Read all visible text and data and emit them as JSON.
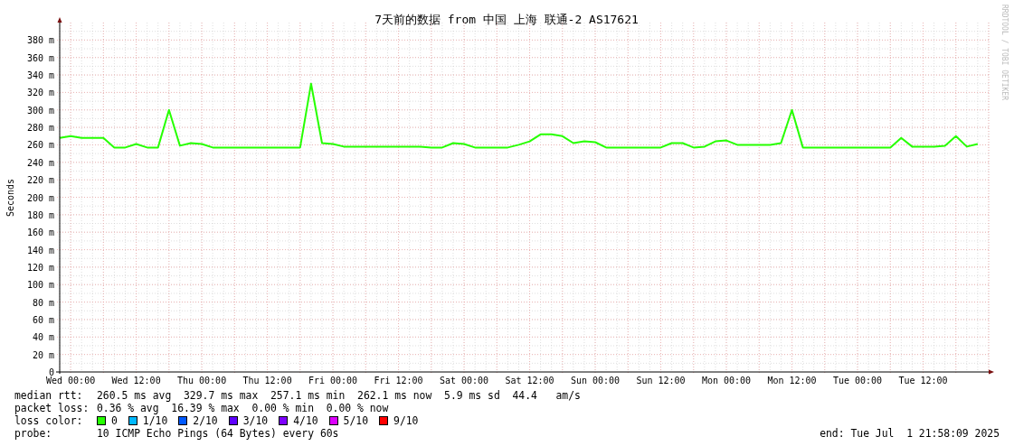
{
  "graph": {
    "watermark": "RRDTOOL / TOBI OETIKER",
    "chart_data": {
      "type": "line",
      "title": "7天前的数据 from 中国 上海 联通-2 AS17621",
      "ylabel": "Seconds",
      "ylim": [
        0,
        400
      ],
      "grid": true,
      "categories": [
        null,
        "Wed 00:00",
        null,
        null,
        null,
        null,
        null,
        "Wed 12:00",
        null,
        null,
        null,
        null,
        null,
        "Thu 00:00",
        null,
        null,
        null,
        null,
        null,
        "Thu 12:00",
        null,
        null,
        null,
        null,
        null,
        "Fri 00:00",
        null,
        null,
        null,
        null,
        null,
        "Fri 12:00",
        null,
        null,
        null,
        null,
        null,
        "Sat 00:00",
        null,
        null,
        null,
        null,
        null,
        "Sat 12:00",
        null,
        null,
        null,
        null,
        null,
        "Sun 00:00",
        null,
        null,
        null,
        null,
        null,
        "Sun 12:00",
        null,
        null,
        null,
        null,
        null,
        "Mon 00:00",
        null,
        null,
        null,
        null,
        null,
        "Mon 12:00",
        null,
        null,
        null,
        null,
        null,
        "Tue 00:00",
        null,
        null,
        null,
        null,
        null,
        "Tue 12:00",
        null,
        null,
        null,
        null,
        null
      ],
      "yticks": [
        {
          "value": 0,
          "label": "0"
        },
        {
          "value": 20,
          "label": "20 m"
        },
        {
          "value": 40,
          "label": "40 m"
        },
        {
          "value": 60,
          "label": "60 m"
        },
        {
          "value": 80,
          "label": "80 m"
        },
        {
          "value": 100,
          "label": "100 m"
        },
        {
          "value": 120,
          "label": "120 m"
        },
        {
          "value": 140,
          "label": "140 m"
        },
        {
          "value": 160,
          "label": "160 m"
        },
        {
          "value": 180,
          "label": "180 m"
        },
        {
          "value": 200,
          "label": "200 m"
        },
        {
          "value": 220,
          "label": "220 m"
        },
        {
          "value": 240,
          "label": "240 m"
        },
        {
          "value": 260,
          "label": "260 m"
        },
        {
          "value": 280,
          "label": "280 m"
        },
        {
          "value": 300,
          "label": "300 m"
        },
        {
          "value": 320,
          "label": "320 m"
        },
        {
          "value": 340,
          "label": "340 m"
        },
        {
          "value": 360,
          "label": "360 m"
        },
        {
          "value": 380,
          "label": "380 m"
        }
      ],
      "series": [
        {
          "name": "median rtt:",
          "color": "#26ff00",
          "values": [
            268,
            270,
            268,
            268,
            268,
            257,
            257,
            261,
            257,
            257,
            300,
            259,
            262,
            261,
            257,
            257,
            257,
            257,
            257,
            257,
            257,
            257,
            257,
            330,
            262,
            261,
            258,
            258,
            258,
            258,
            258,
            258,
            258,
            258,
            257,
            257,
            262,
            261,
            257,
            257,
            257,
            257,
            260,
            264,
            272,
            272,
            270,
            262,
            264,
            263,
            257,
            257,
            257,
            257,
            257,
            257,
            262,
            262,
            257,
            258,
            264,
            265,
            260,
            260,
            260,
            260,
            262,
            300,
            257,
            257,
            257,
            257,
            257,
            257,
            257,
            257,
            257,
            268,
            258,
            258,
            258,
            259,
            270,
            258,
            261
          ]
        }
      ]
    }
  },
  "legend": {
    "median_rtt": {
      "value": "260.5 ms avg  329.7 ms max  257.1 ms min  262.1 ms now  5.9 ms sd  44.4   am/s"
    },
    "packet_loss": {
      "label": "packet loss:",
      "value": "0.36 % avg  16.39 % max  0.00 % min  0.00 % now"
    },
    "loss_color": {
      "label": "loss color:",
      "items": [
        {
          "label": "0",
          "color": "#26ff00"
        },
        {
          "label": "1/10",
          "color": "#00b8ff"
        },
        {
          "label": "2/10",
          "color": "#0059ff"
        },
        {
          "label": "3/10",
          "color": "#5e00ff"
        },
        {
          "label": "4/10",
          "color": "#7e00ff"
        },
        {
          "label": "5/10",
          "color": "#dd00ff"
        },
        {
          "label": "9/10",
          "color": "#ff0000"
        }
      ]
    },
    "probe": {
      "label": "probe:",
      "value": "10 ICMP Echo Pings (64 Bytes) every 60s"
    },
    "end": "end: Tue Jul  1 21:58:09 2025"
  }
}
